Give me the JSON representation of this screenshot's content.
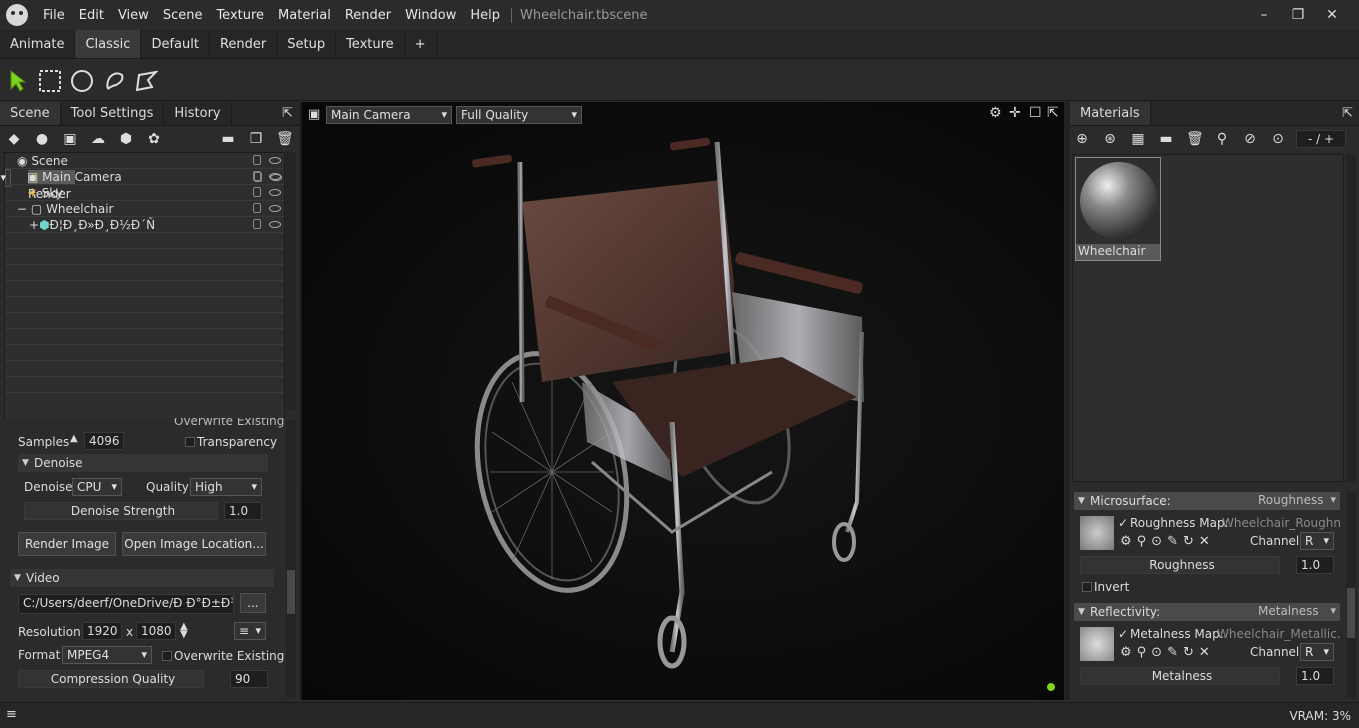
{
  "titlebar": {
    "menu": [
      "File",
      "Edit",
      "View",
      "Scene",
      "Texture",
      "Material",
      "Render",
      "Window",
      "Help"
    ],
    "document": "Wheelchair.tbscene",
    "controls": [
      "–",
      "❐",
      "✕"
    ]
  },
  "workspace_tabs": [
    "Animate",
    "Classic",
    "Default",
    "Render",
    "Setup",
    "Texture",
    "+"
  ],
  "active_tab": "Classic",
  "left_panel": {
    "tabs": [
      "Scene",
      "Tool Settings",
      "History"
    ],
    "tree": [
      {
        "label": "Scene",
        "indent": 0,
        "icon": "scene-icon"
      },
      {
        "label": "Render",
        "indent": 1,
        "icon": "render-icon",
        "selected": true
      },
      {
        "label": "Main Camera",
        "indent": 1,
        "icon": "camera-icon"
      },
      {
        "label": "Sky",
        "indent": 1,
        "icon": "sky-icon"
      },
      {
        "label": "Wheelchair",
        "indent": 1,
        "icon": "object-icon"
      },
      {
        "label": "Đ¦Đ¸Đ»Đ¸Đ½Đ´Ñ",
        "indent": 2,
        "icon": "mesh-icon"
      }
    ],
    "render": {
      "cutoff_label": "Overwrite Existing",
      "samples_label": "Samples",
      "samples_value": "4096",
      "transparency_label": "Transparency",
      "denoise_section": "Denoise",
      "denoise_label": "Denoise",
      "denoise_value": "CPU",
      "quality_label": "Quality",
      "quality_value": "High",
      "denoise_strength_label": "Denoise Strength",
      "denoise_strength_value": "1.0",
      "render_image_button": "Render Image",
      "open_location_button": "Open Image Location...",
      "video_section": "Video",
      "video_path": "C:/Users/deerf/OneDrive/Đ Đ°Đ±Đ¾Ñ",
      "browse_button": "...",
      "resolution_label": "Resolution:",
      "res_width": "1920",
      "res_x": "x",
      "res_height": "1080",
      "format_label": "Format",
      "format_value": "MPEG4",
      "overwrite_label": "Overwrite Existing",
      "compression_label": "Compression Quality",
      "compression_value": "90"
    }
  },
  "viewport": {
    "camera": "Main Camera",
    "quality": "Full Quality"
  },
  "right_panel": {
    "tab": "Materials",
    "counter": "- / +",
    "material_name": "Wheelchair",
    "microsurface": {
      "section": "Microsurface:",
      "mode": "Roughness",
      "map_label": "Roughness Map:",
      "map_file": "Wheelchair_Roughness",
      "channel_label": "Channel",
      "channel_value": "R",
      "slider_label": "Roughness",
      "slider_value": "1.0",
      "invert_label": "Invert"
    },
    "reflectivity": {
      "section": "Reflectivity:",
      "mode": "Metalness",
      "map_label": "Metalness Map:",
      "map_file": "Wheelchair_Metallic.pn",
      "channel_label": "Channel",
      "channel_value": "R",
      "slider_label": "Metalness",
      "slider_value": "1.0"
    }
  },
  "status": {
    "vram": "VRAM: 3%"
  }
}
